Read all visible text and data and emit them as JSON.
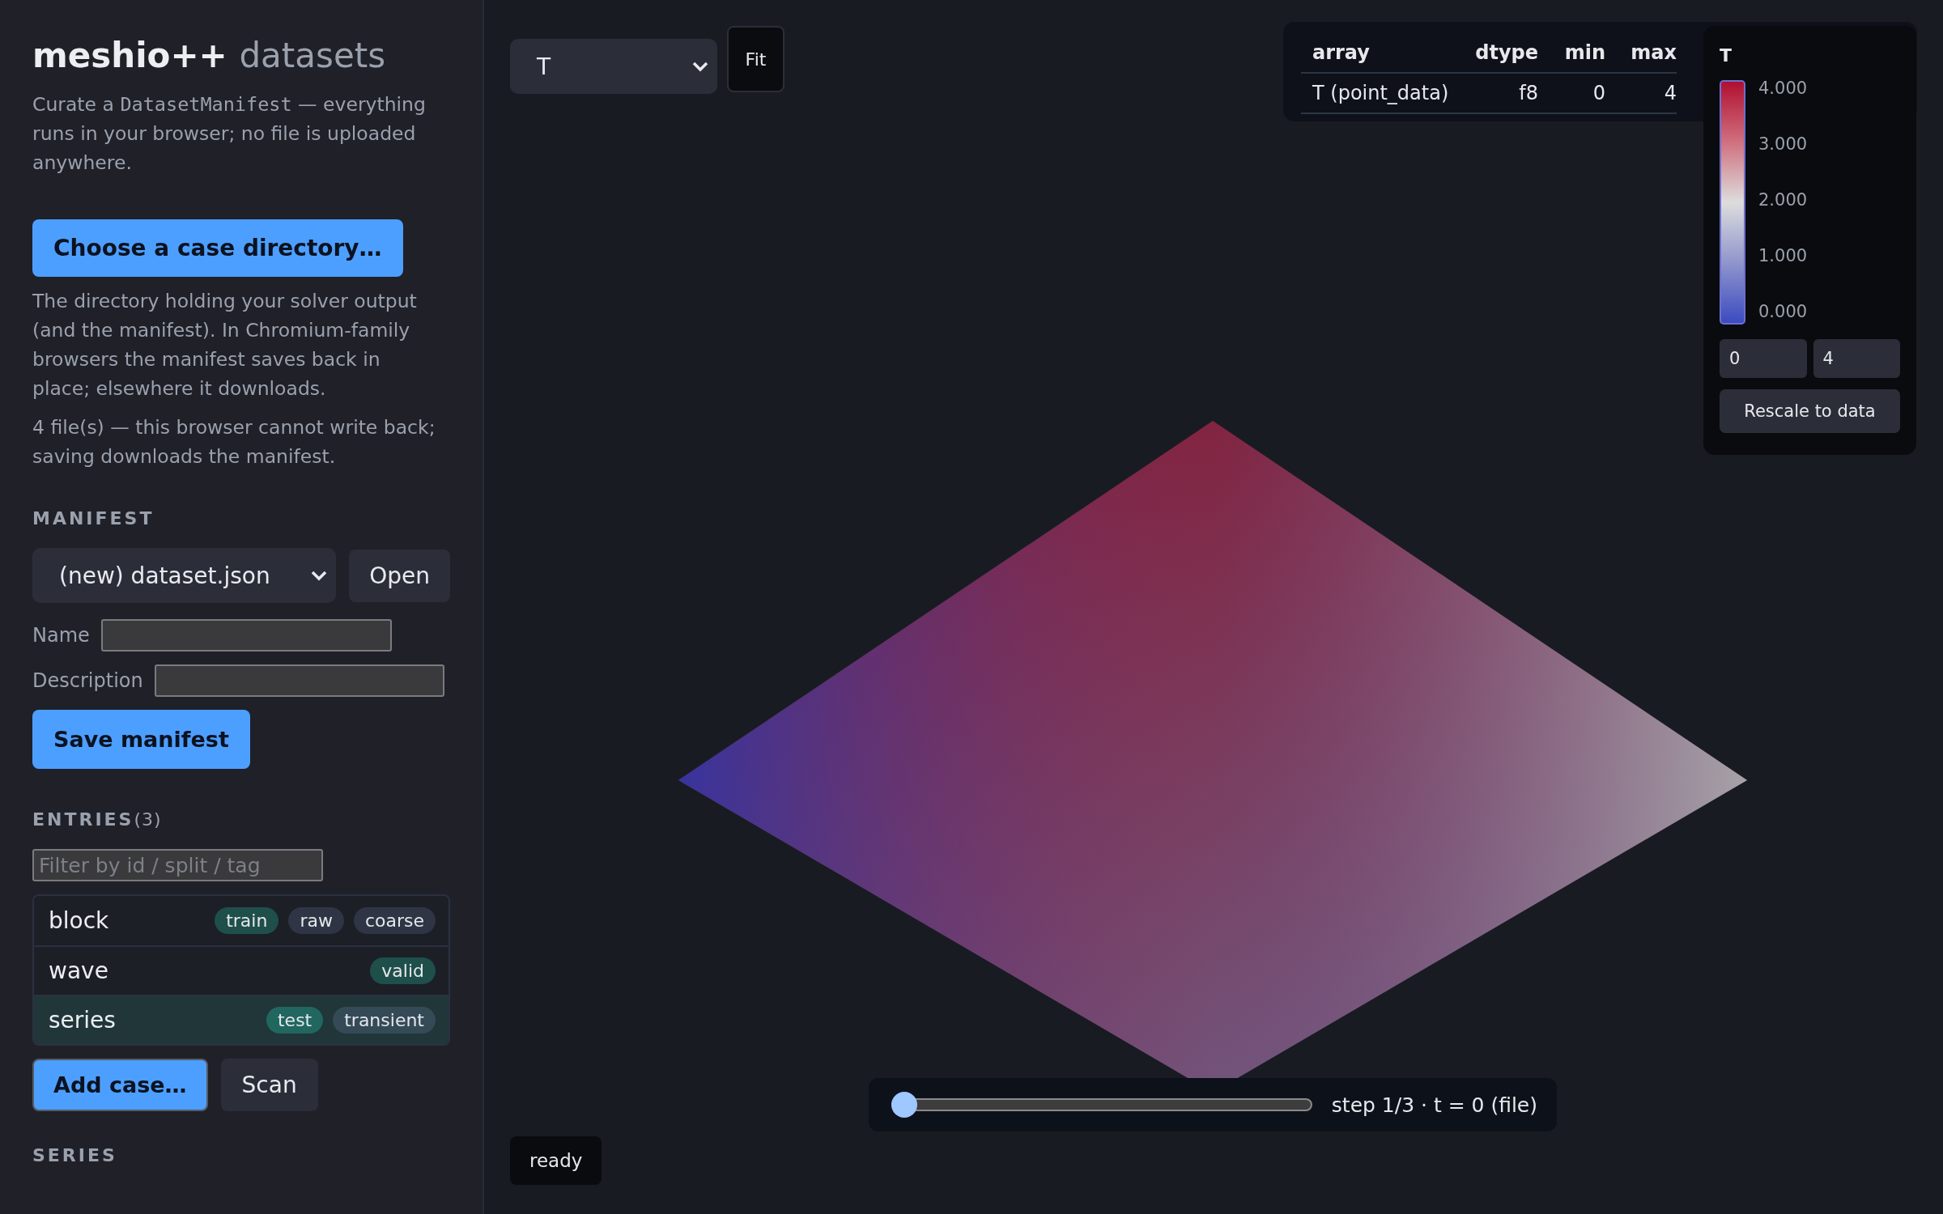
{
  "sidebar": {
    "title": {
      "brand": "meshio++",
      "suffix": "datasets"
    },
    "intro": [
      "Curate a ",
      "DatasetManifest",
      " — everything runs in your browser; no file is uploaded anywhere."
    ],
    "choose_button": "Choose a case directory…",
    "help": "The directory holding your solver output (and the manifest). In Chromium-family browsers the manifest saves back in place; elsewhere it downloads.",
    "status": "4 file(s) — this browser cannot write back; saving downloads the manifest.",
    "manifest": {
      "heading": "MANIFEST",
      "select": "(new) dataset.json",
      "open_button": "Open",
      "fields": [
        {
          "label": "Name"
        },
        {
          "label": "Description"
        }
      ],
      "save_button": "Save manifest"
    },
    "entries": {
      "heading": "ENTRIES",
      "count": "(3)",
      "filter_placeholder": "Filter by id / split / tag",
      "items": [
        {
          "id": "block",
          "selected": false,
          "tags": [
            {
              "label": "train",
              "color": "#1f4f4b"
            },
            {
              "label": "raw",
              "color": "#2f3545"
            },
            {
              "label": "coarse",
              "color": "#2f3545"
            }
          ]
        },
        {
          "id": "wave",
          "selected": false,
          "tags": [
            {
              "label": "valid",
              "color": "#1f4f4b"
            }
          ]
        },
        {
          "id": "series",
          "selected": true,
          "tags": [
            {
              "label": "test",
              "color": "#226660"
            },
            {
              "label": "transient",
              "color": "#354a57"
            }
          ]
        }
      ],
      "add_button": "Add case…",
      "scan_button": "Scan"
    },
    "series_heading": "SERIES"
  },
  "viewport": {
    "array_select": "T",
    "fit_button": "Fit",
    "table": {
      "columns": [
        "array",
        "dtype",
        "min",
        "max"
      ],
      "rows": [
        [
          "T (point_data)",
          "f8",
          "0",
          "4"
        ]
      ]
    },
    "colorbar": {
      "title": "T",
      "ticks": [
        "4.000",
        "3.000",
        "2.000",
        "1.000",
        "0.000"
      ],
      "min": "0",
      "max": "4",
      "rescale_button": "Rescale to data"
    },
    "timeline": {
      "level": 0,
      "label": "step 1/3 · t = 0 (file)"
    },
    "status": "ready"
  }
}
